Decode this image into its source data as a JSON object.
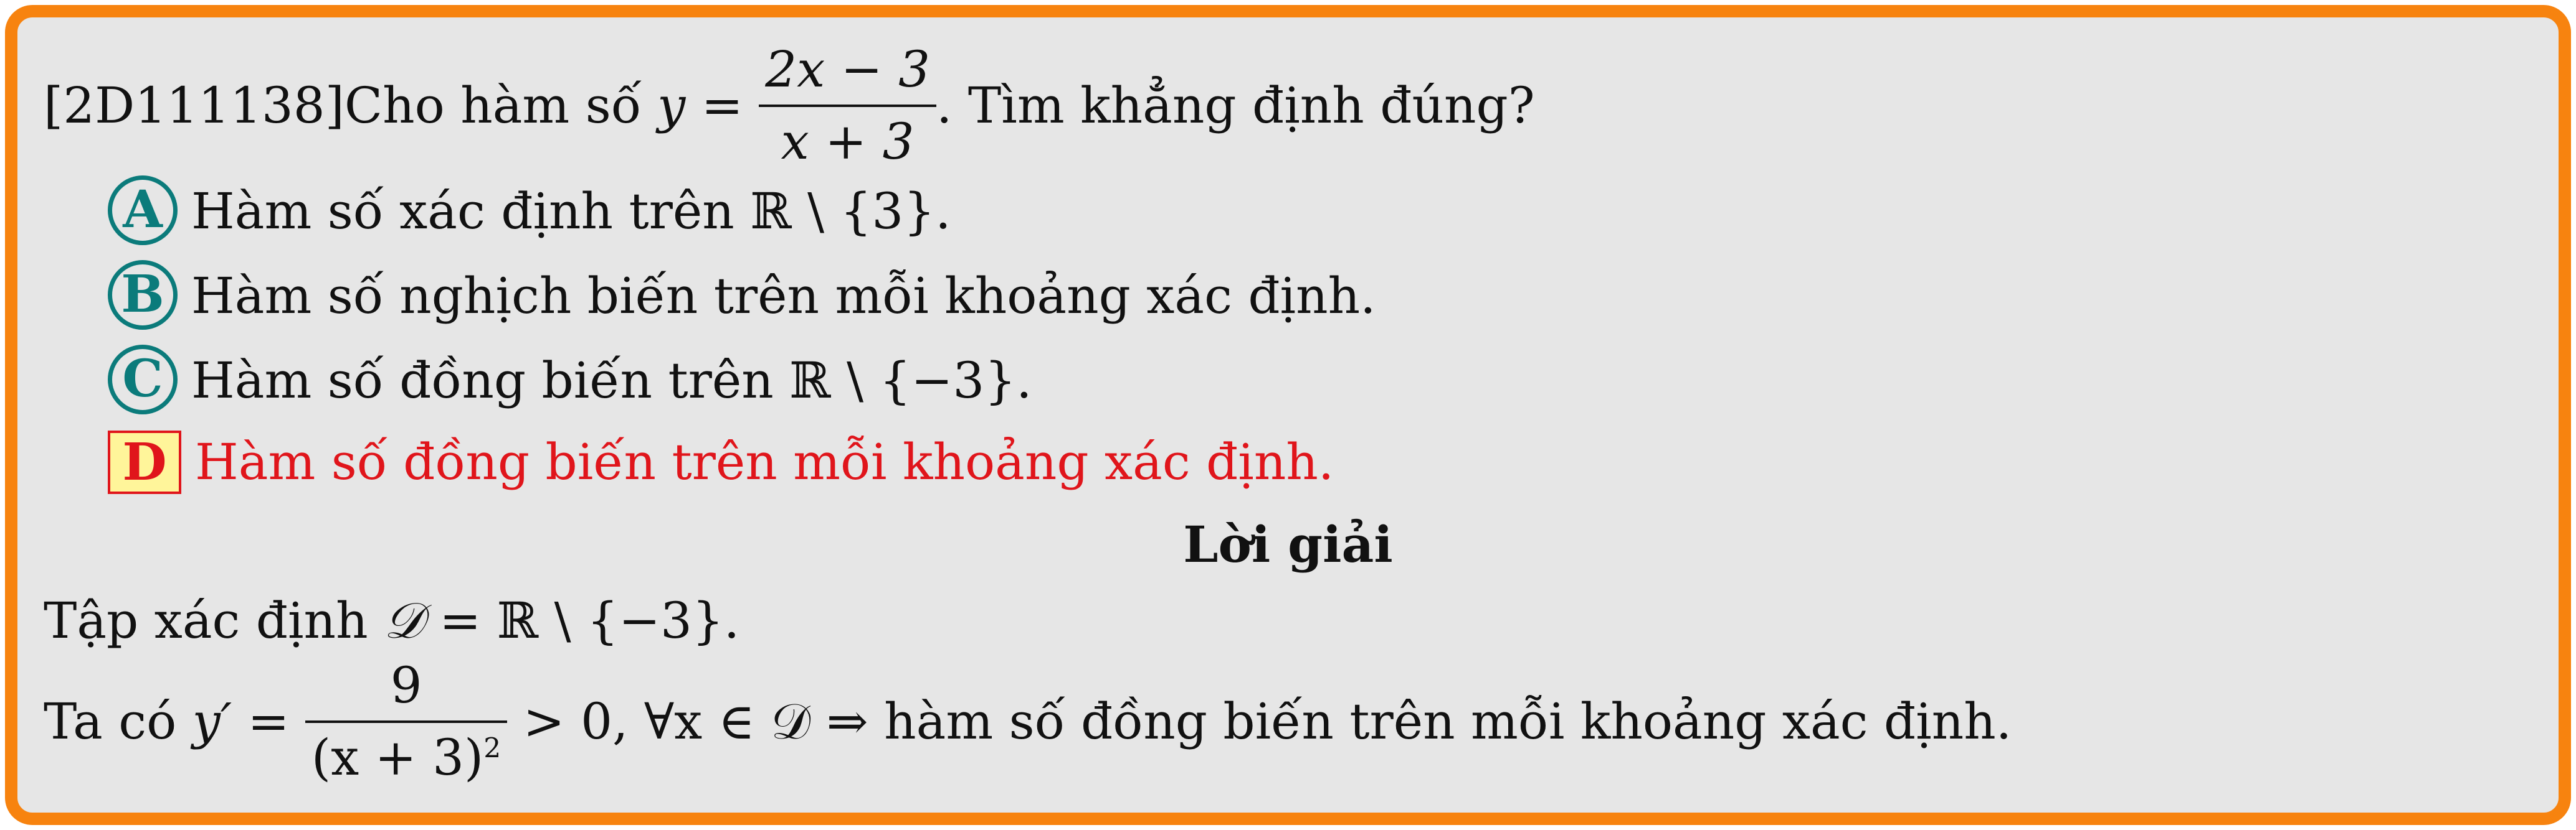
{
  "question": {
    "code": "[2D111138]",
    "prefix": "Cho hàm số ",
    "func_var": "y",
    "equals": " = ",
    "numerator": "2x − 3",
    "denominator": "x + 3",
    "suffix": ". Tìm khẳng định đúng?"
  },
  "choices": [
    {
      "label": "A",
      "text": "Hàm số xác định trên ℝ \\ {3}."
    },
    {
      "label": "B",
      "text": "Hàm số nghịch biến trên mỗi khoảng xác định."
    },
    {
      "label": "C",
      "text": "Hàm số đồng biến trên ℝ \\ {−3}."
    },
    {
      "label": "D",
      "text": "Hàm số đồng biến trên mỗi khoảng xác định."
    }
  ],
  "correct_choice": "D",
  "solution": {
    "heading": "Lời giải",
    "line1_prefix": "Tập xác định ",
    "line1_domain": "𝒟",
    "line1_rest": " = ℝ \\ {−3}.",
    "line2_prefix": "Ta có ",
    "line2_lhs": "y′ = ",
    "line2_num": "9",
    "line2_den_base": "(x + 3)",
    "line2_den_exp": "2",
    "line2_rest": " > 0, ∀x ∈ 𝒟 ⇒ hàm số đồng biến trên mỗi khoảng xác định."
  },
  "colors": {
    "border": "#f7830f",
    "background": "#e6e6e6",
    "circle": "#0b7b7b",
    "correct": "#e0151b",
    "highlight": "#fff59a"
  }
}
